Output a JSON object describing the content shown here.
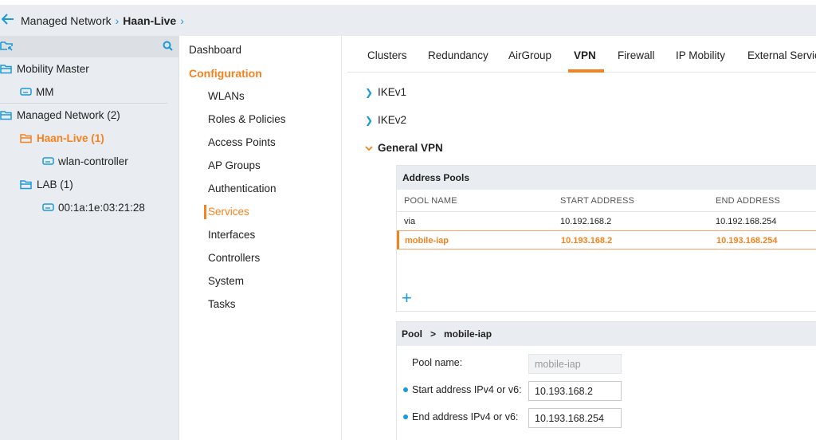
{
  "breadcrumb": {
    "back_icon": "arrow-left-icon",
    "items": [
      "Managed Network"
    ],
    "current": "Haan-Live"
  },
  "tree": {
    "header_icons": [
      "folder-collapse-icon",
      "search-icon"
    ],
    "items": [
      {
        "label": "Mobility Master",
        "icon": "folder-icon",
        "level": 0
      },
      {
        "label": "MM",
        "icon": "device-icon",
        "level": 1
      },
      {
        "label": "Managed Network (2)",
        "icon": "folder-icon",
        "level": 0
      },
      {
        "label": "Haan-Live (1)",
        "icon": "folder-icon",
        "level": 1,
        "active": true
      },
      {
        "label": "wlan-controller",
        "icon": "device-icon",
        "level": 2
      },
      {
        "label": "LAB (1)",
        "icon": "folder-icon",
        "level": 1
      },
      {
        "label": "00:1a:1e:03:21:28",
        "icon": "device-icon",
        "level": 2
      }
    ]
  },
  "nav": {
    "dashboard": "Dashboard",
    "configuration": "Configuration",
    "items": [
      "WLANs",
      "Roles & Policies",
      "Access Points",
      "AP Groups",
      "Authentication",
      "Services",
      "Interfaces",
      "Controllers",
      "System",
      "Tasks"
    ],
    "selected": "Services"
  },
  "tabs": {
    "items": [
      "Clusters",
      "Redundancy",
      "AirGroup",
      "VPN",
      "Firewall",
      "IP Mobility",
      "External Servic"
    ],
    "active": "VPN"
  },
  "accordion": [
    {
      "label": "IKEv1",
      "open": false
    },
    {
      "label": "IKEv2",
      "open": false
    },
    {
      "label": "General VPN",
      "open": true
    }
  ],
  "address_pools": {
    "title": "Address Pools",
    "columns": [
      "POOL NAME",
      "START ADDRESS",
      "END ADDRESS"
    ],
    "rows": [
      {
        "name": "via",
        "start": "10.192.168.2",
        "end": "10.192.168.254",
        "selected": false
      },
      {
        "name": "mobile-iap",
        "start": "10.193.168.2",
        "end": "10.193.168.254",
        "selected": true
      }
    ],
    "add_label": "+"
  },
  "pool_detail": {
    "header": "Pool",
    "header_sep": ">",
    "pool_name": "mobile-iap",
    "fields": [
      {
        "label": "Pool name:",
        "value": "mobile-iap",
        "required": false,
        "disabled": true
      },
      {
        "label": "Start address IPv4 or v6:",
        "value": "10.193.168.2",
        "required": true,
        "disabled": false
      },
      {
        "label": "End address IPv4 or v6:",
        "value": "10.193.168.254",
        "required": true,
        "disabled": false
      }
    ]
  },
  "colors": {
    "accent_orange": "#f5821f",
    "accent_blue": "#1a9ad9",
    "panel_gray": "#e9ecf0"
  }
}
